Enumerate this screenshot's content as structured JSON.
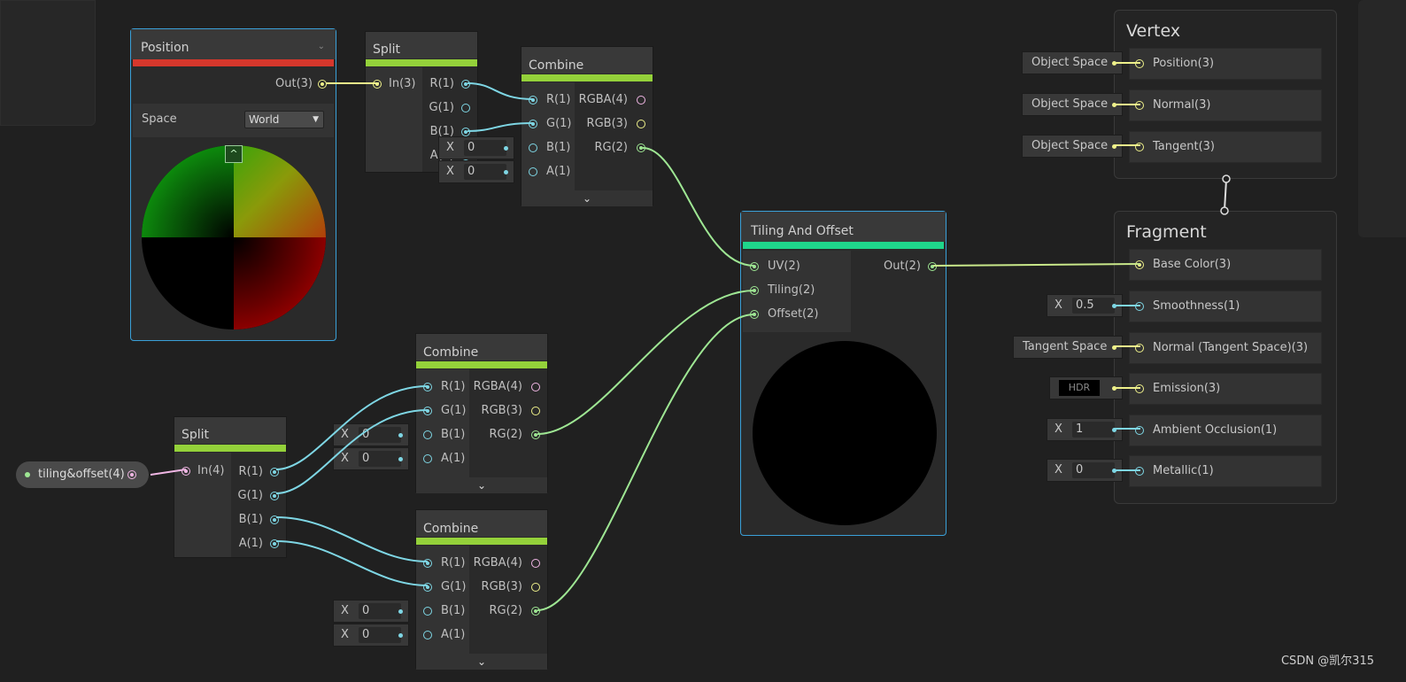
{
  "position_node": {
    "title": "Position",
    "output": "Out(3)",
    "space_label": "Space",
    "space_value": "World"
  },
  "split_top": {
    "title": "Split",
    "input": "In(3)",
    "outputs": [
      "R(1)",
      "G(1)",
      "B(1)",
      "A(1)"
    ]
  },
  "combine_top": {
    "title": "Combine",
    "inputs": [
      "R(1)",
      "G(1)",
      "B(1)",
      "A(1)"
    ],
    "outputs": [
      "RGBA(4)",
      "RGB(3)",
      "RG(2)"
    ],
    "defaults": {
      "x_label": "X",
      "b": "0",
      "a": "0"
    }
  },
  "property": {
    "label": "tiling&offset(4)"
  },
  "split_bottom": {
    "title": "Split",
    "input": "In(4)",
    "outputs": [
      "R(1)",
      "G(1)",
      "B(1)",
      "A(1)"
    ]
  },
  "combine_mid": {
    "title": "Combine",
    "inputs": [
      "R(1)",
      "G(1)",
      "B(1)",
      "A(1)"
    ],
    "outputs": [
      "RGBA(4)",
      "RGB(3)",
      "RG(2)"
    ],
    "defaults": {
      "x_label": "X",
      "b": "0",
      "a": "0"
    }
  },
  "combine_bot": {
    "title": "Combine",
    "inputs": [
      "R(1)",
      "G(1)",
      "B(1)",
      "A(1)"
    ],
    "outputs": [
      "RGBA(4)",
      "RGB(3)",
      "RG(2)"
    ],
    "defaults": {
      "x_label": "X",
      "b": "0",
      "a": "0"
    }
  },
  "tiling": {
    "title": "Tiling And Offset",
    "inputs": [
      "UV(2)",
      "Tiling(2)",
      "Offset(2)"
    ],
    "output": "Out(2)"
  },
  "vertex": {
    "title": "Vertex",
    "slots": [
      "Position(3)",
      "Normal(3)",
      "Tangent(3)"
    ],
    "defaults": [
      "Object Space",
      "Object Space",
      "Object Space"
    ]
  },
  "fragment": {
    "title": "Fragment",
    "slots": [
      "Base Color(3)",
      "Smoothness(1)",
      "Normal (Tangent Space)(3)",
      "Emission(3)",
      "Ambient Occlusion(1)",
      "Metallic(1)"
    ],
    "defaults": {
      "x_label": "X",
      "smoothness": "0.5",
      "normal_space": "Tangent Space",
      "emission": "HDR",
      "ao": "1",
      "metallic": "0"
    }
  },
  "watermark": "CSDN @凯尔315",
  "colors": {
    "selection": "#3aa0d8",
    "position_bar": "#d6372c",
    "split_bar": "#94d13a",
    "tiling_bar": "#1fd58b"
  }
}
